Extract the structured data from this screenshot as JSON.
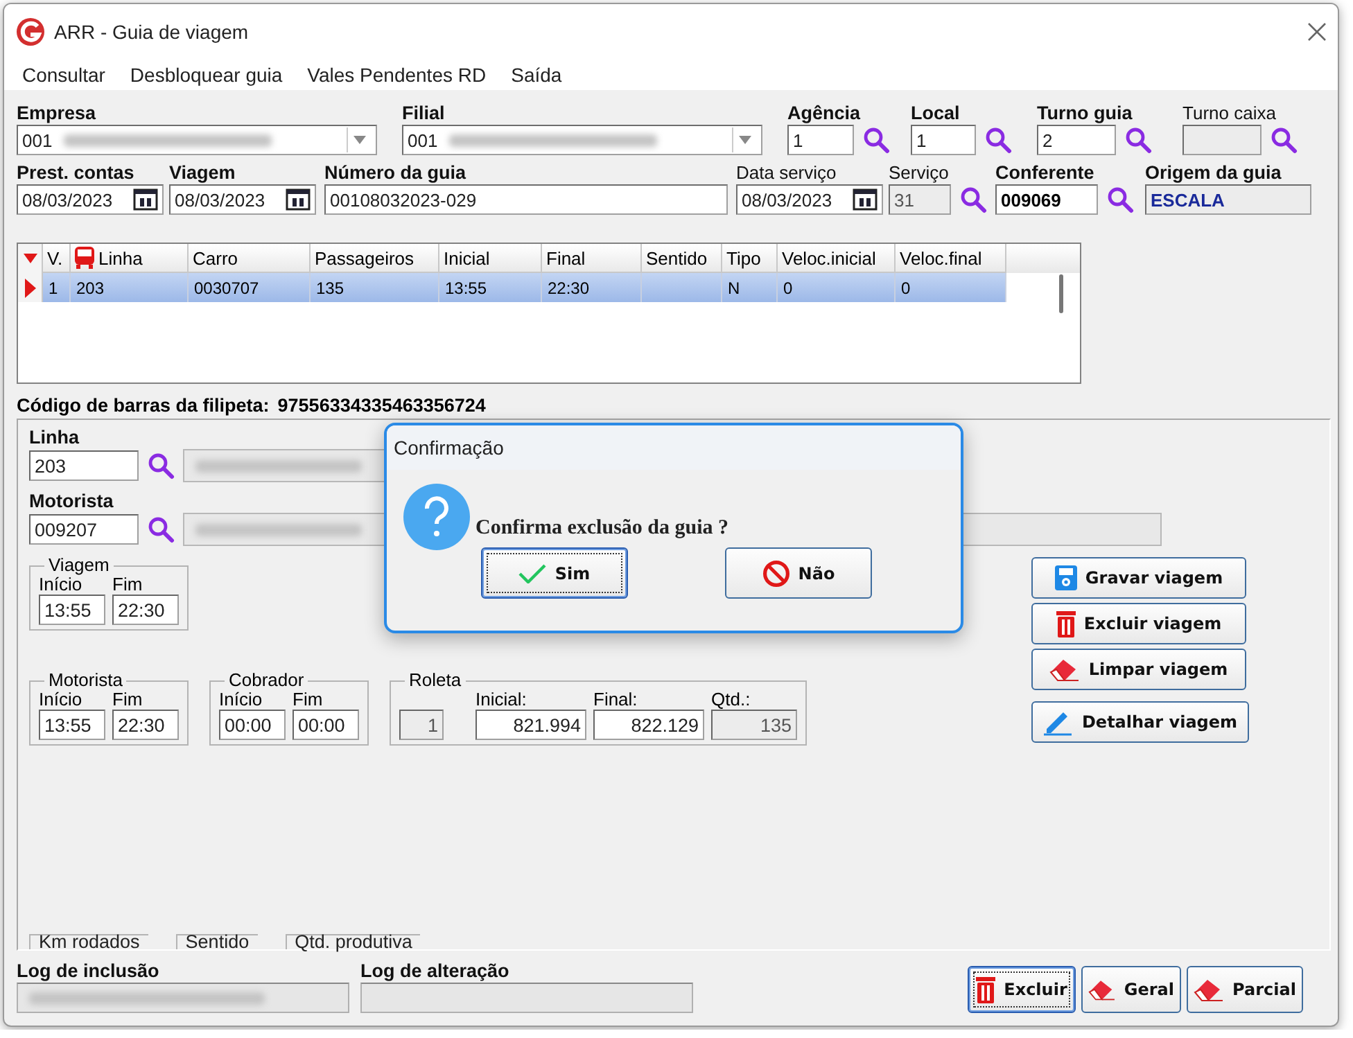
{
  "window": {
    "title": "ARR - Guia de viagem"
  },
  "menu": [
    "Consultar",
    "Desbloquear guia",
    "Vales Pendentes RD",
    "Saída"
  ],
  "header_rows": [
    [
      {
        "label": "Empresa",
        "kind": "dropdown",
        "value": "001",
        "blurred": true,
        "bold": true
      },
      {
        "label": "Filial",
        "kind": "dropdown",
        "value": "001",
        "blurred": true,
        "bold": true
      },
      {
        "label": "Agência",
        "kind": "lookup",
        "value": "1",
        "bold": true
      },
      {
        "label": "Local",
        "kind": "lookup",
        "value": "1",
        "bold": true
      },
      {
        "label": "Turno guia",
        "kind": "lookup",
        "value": "2",
        "bold": true
      },
      {
        "label": "Turno caixa",
        "kind": "lookup",
        "disabled": true,
        "bold": false
      }
    ],
    [
      {
        "label": "Prest. contas",
        "kind": "date",
        "value": "08/03/2023",
        "bold": true
      },
      {
        "label": "Viagem",
        "kind": "date",
        "value": "08/03/2023",
        "bold": true
      },
      {
        "label": "Número da guia",
        "kind": "text",
        "value": "00108032023-029",
        "bold": true
      },
      {
        "label": "Data serviço",
        "kind": "date",
        "value": "08/03/2023",
        "bold": false
      },
      {
        "label": "Serviço",
        "kind": "lookup",
        "value": "31",
        "disabled": true,
        "bold": false
      },
      {
        "label": "Conferente",
        "kind": "lookup",
        "value": "009069",
        "strong": true,
        "bold": true
      },
      {
        "label": "Origem da guia",
        "kind": "text",
        "value": "ESCALA",
        "disabled": true,
        "strong": true,
        "bold": true
      }
    ]
  ],
  "grid": {
    "columns": [
      "V.",
      "Linha",
      "Carro",
      "Passageiros",
      "Inicial",
      "Final",
      "Sentido",
      "Tipo",
      "Veloc.inicial",
      "Veloc.final"
    ],
    "rows": [
      {
        "selected": true,
        "cells": [
          "1",
          "203",
          "0030707",
          "135",
          "13:55",
          "22:30",
          "",
          "N",
          "0",
          "0"
        ]
      }
    ]
  },
  "barcode": {
    "label": "Código de barras da filipeta:",
    "value": "97556334335463356724"
  },
  "linha": {
    "label": "Linha",
    "value": "203"
  },
  "motorista": {
    "label": "Motorista",
    "value": "009207"
  },
  "groups": [
    {
      "title": "Viagem",
      "fields": [
        {
          "label": "Início",
          "value": "13:55"
        },
        {
          "label": "Fim",
          "value": "22:30"
        }
      ]
    },
    {
      "title": "Motorista",
      "fields": [
        {
          "label": "Início",
          "value": "13:55"
        },
        {
          "label": "Fim",
          "value": "22:30"
        }
      ]
    },
    {
      "title": "Cobrador",
      "fields": [
        {
          "label": "Início",
          "value": "00:00"
        },
        {
          "label": "Fim",
          "value": "00:00"
        }
      ]
    },
    {
      "title": "Roleta",
      "fields": [
        {
          "value": "1",
          "disabled": true
        },
        {
          "label": "Inicial:",
          "value": "821.994"
        },
        {
          "label": "Final:",
          "value": "822.129"
        },
        {
          "label": "Qtd.:",
          "value": "135",
          "disabled": true
        }
      ]
    }
  ],
  "side_buttons": [
    {
      "label": "Gravar viagem",
      "kind": "save"
    },
    {
      "label": "Excluir viagem",
      "kind": "trash"
    },
    {
      "label": "Limpar viagem",
      "kind": "eraser"
    },
    {
      "label": "Detalhar viagem",
      "kind": "pencil"
    }
  ],
  "bottom_frames": [
    "Km rodados",
    "Sentido",
    "Qtd. produtiva"
  ],
  "logs": [
    {
      "label": "Log de inclusão",
      "blurred": true
    },
    {
      "label": "Log de alteração",
      "blurred": false
    }
  ],
  "bottom_buttons": [
    {
      "label": "Excluir",
      "kind": "trash",
      "focused": true
    },
    {
      "label": "Geral",
      "kind": "eraser",
      "focused": false
    },
    {
      "label": "Parcial",
      "kind": "eraser",
      "focused": false
    }
  ],
  "dialog": {
    "title": "Confirmação",
    "message": "Confirma exclusão da guia ?",
    "buttons": [
      {
        "label": "Sim",
        "kind": "check",
        "focused": true
      },
      {
        "label": "Não",
        "kind": "no",
        "focused": false
      }
    ]
  }
}
